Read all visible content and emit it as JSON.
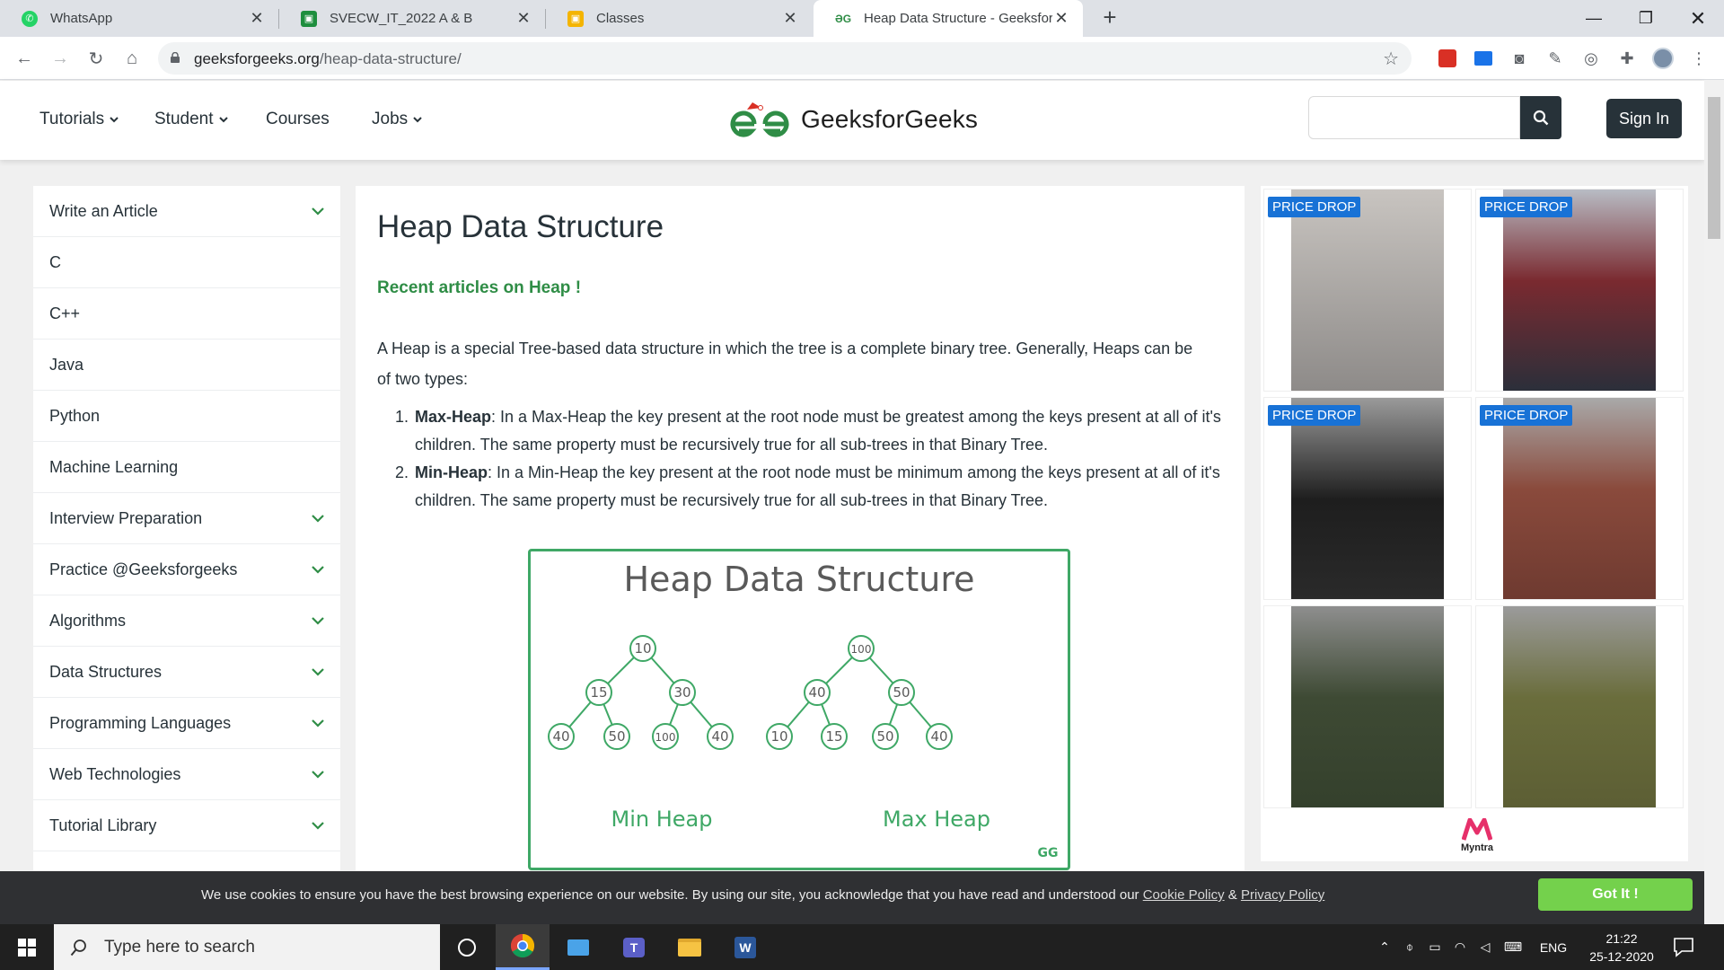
{
  "browser": {
    "tabs": [
      {
        "label": "WhatsApp",
        "active": false
      },
      {
        "label": "SVECW_IT_2022 A & B",
        "active": false
      },
      {
        "label": "Classes",
        "active": false
      },
      {
        "label": "Heap Data Structure - GeeksforG",
        "active": true
      }
    ],
    "url_domain": "geeksforgeeks.org",
    "url_path": "/heap-data-structure/"
  },
  "header": {
    "nav": [
      {
        "label": "Tutorials",
        "has_dropdown": true
      },
      {
        "label": "Student",
        "has_dropdown": true
      },
      {
        "label": "Courses",
        "has_dropdown": false
      },
      {
        "label": "Jobs",
        "has_dropdown": true
      }
    ],
    "logo_text": "GeeksforGeeks",
    "search_placeholder": "",
    "signin_label": "Sign In"
  },
  "sidebar": {
    "items": [
      {
        "label": "Write an Article",
        "expandable": true
      },
      {
        "label": "C",
        "expandable": false
      },
      {
        "label": "C++",
        "expandable": false
      },
      {
        "label": "Java",
        "expandable": false
      },
      {
        "label": "Python",
        "expandable": false
      },
      {
        "label": "Machine Learning",
        "expandable": false
      },
      {
        "label": "Interview Preparation",
        "expandable": true
      },
      {
        "label": "Practice @Geeksforgeeks",
        "expandable": true
      },
      {
        "label": "Algorithms",
        "expandable": true
      },
      {
        "label": "Data Structures",
        "expandable": true
      },
      {
        "label": "Programming Languages",
        "expandable": true
      },
      {
        "label": "Web Technologies",
        "expandable": true
      },
      {
        "label": "Tutorial Library",
        "expandable": true
      },
      {
        "label": "",
        "expandable": true
      }
    ]
  },
  "article": {
    "title": "Heap Data Structure",
    "recent_link": "Recent articles on Heap !",
    "intro": "A Heap is a special Tree-based data structure in which the tree is a complete binary tree. Generally, Heaps can be of two types:",
    "types": [
      {
        "num": "1.",
        "term": "Max-Heap",
        "text": ": In a Max-Heap the key present at the root node must be greatest among the keys present at all of it's children. The same property must be recursively true for all sub-trees in that Binary Tree."
      },
      {
        "num": "2.",
        "term": "Min-Heap",
        "text": ": In a Min-Heap the key present at the root node must be minimum among the keys present at all of it's children. The same property must be recursively true for all sub-trees in that Binary Tree."
      }
    ],
    "figure": {
      "title": "Heap Data Structure",
      "min_heap_label": "Min Heap",
      "max_heap_label": "Max Heap",
      "min_heap_nodes": [
        "10",
        "15",
        "30",
        "40",
        "50",
        "100",
        "40"
      ],
      "max_heap_nodes": [
        "100",
        "40",
        "50",
        "10",
        "15",
        "50",
        "40"
      ],
      "watermark": "GG",
      "accent": "#3fa866"
    }
  },
  "ad": {
    "badge": "PRICE DROP",
    "brand": "Myntra",
    "close_glyph": "✕",
    "info_glyph": "ⓘ"
  },
  "cookie": {
    "text_before": "We use cookies to ensure you have the best browsing experience on our website. By using our site, you acknowledge that you have read and understood our ",
    "cookie_policy": "Cookie Policy",
    "amp": " & ",
    "privacy_policy": "Privacy Policy",
    "button": "Got It !"
  },
  "taskbar": {
    "search_placeholder": "Type here to search",
    "language": "ENG",
    "time": "21:22",
    "date": "25-12-2020"
  },
  "colors": {
    "gfg_green": "#2f8d46",
    "gfg_dark": "#273239",
    "cookie_button": "#74d14c",
    "price_badge": "#1872d6"
  }
}
